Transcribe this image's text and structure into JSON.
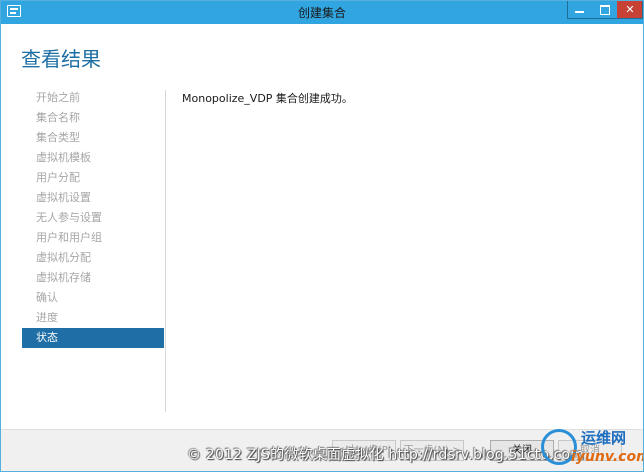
{
  "window": {
    "title": "创建集合"
  },
  "page": {
    "heading": "查看结果"
  },
  "steps": [
    {
      "label": "开始之前"
    },
    {
      "label": "集合名称"
    },
    {
      "label": "集合类型"
    },
    {
      "label": "虚拟机模板"
    },
    {
      "label": "用户分配"
    },
    {
      "label": "虚拟机设置"
    },
    {
      "label": "无人参与设置"
    },
    {
      "label": "用户和用户组"
    },
    {
      "label": "虚拟机分配"
    },
    {
      "label": "虚拟机存储"
    },
    {
      "label": "确认"
    },
    {
      "label": "进度"
    },
    {
      "label": "状态",
      "active": true
    }
  ],
  "main": {
    "message": "Monopolize_VDP 集合创建成功。"
  },
  "footer": {
    "prev_label": "< 上一步(P)",
    "next_label": "下一步(N) >",
    "close_label": "关闭",
    "cancel_label": "取消"
  },
  "watermark": {
    "text": "© 2012 ZJS的微软桌面虚拟化 http://rdsrv.blog.51cto.com",
    "logo_line1": "运维网",
    "logo_line2": "iyunv.com"
  }
}
